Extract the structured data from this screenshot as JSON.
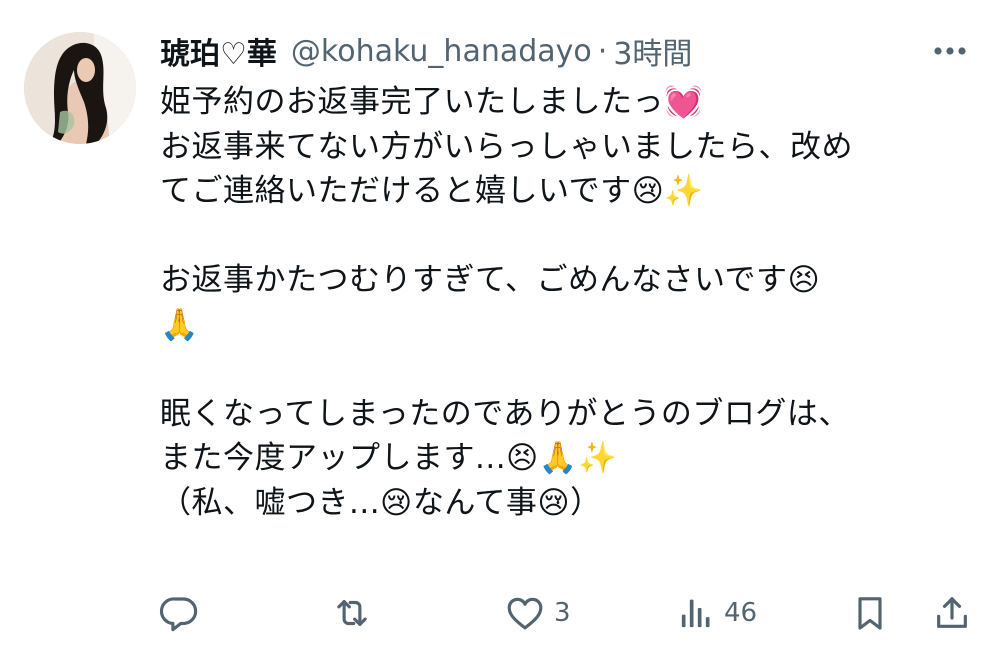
{
  "header": {
    "display_name": "琥珀♡華",
    "handle": "@kohaku_hanadayo",
    "separator": "·",
    "time": "3時間"
  },
  "tweet": {
    "text": "姫予約のお返事完了いたしましたっ💓\nお返事来てない方がいらっしゃいましたら、改め\nてご連絡いただけると嬉しいです😢✨\n\nお返事かたつむりすぎて、ごめんなさいです😣\n🙏\n\n眠くなってしまったのでありがとうのブログは、\nまた今度アップします...😣🙏✨\n（私、嘘つき...😢なんて事😢）"
  },
  "actions": {
    "reply_count": "",
    "retweet_count": "",
    "like_count": "3",
    "views_count": "46"
  },
  "icons": {
    "more": "more-horizontal-icon",
    "reply": "reply-icon",
    "retweet": "retweet-icon",
    "like": "heart-icon",
    "views": "views-chart-icon",
    "bookmark": "bookmark-icon",
    "share": "share-icon"
  },
  "colors": {
    "text": "#0f1419",
    "secondary": "#536471"
  }
}
